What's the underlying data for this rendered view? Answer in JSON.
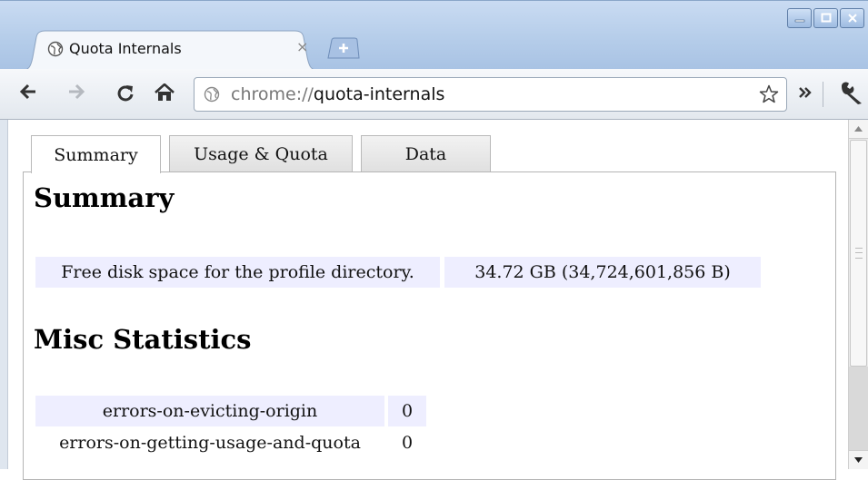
{
  "window": {
    "controls": [
      "minimize",
      "maximize",
      "close"
    ]
  },
  "tab": {
    "title": "Quota Internals",
    "close_glyph": "×",
    "favicon": "globe-icon"
  },
  "toolbar": {
    "icons": [
      "back-arrow-icon",
      "forward-arrow-icon",
      "reload-icon",
      "home-icon",
      "bookmark-star-icon",
      "overflow-chevron-icon",
      "wrench-icon"
    ],
    "url_scheme": "chrome://",
    "url_host": "quota-internals"
  },
  "page": {
    "tabs": [
      "Summary",
      "Usage & Quota",
      "Data"
    ],
    "active_tab": "Summary",
    "summary_heading": "Summary",
    "summary_row": {
      "label": "Free disk space for the profile directory.",
      "value": "34.72 GB (34,724,601,856 B)"
    },
    "misc_heading": "Misc Statistics",
    "statistics": [
      {
        "name": "errors-on-evicting-origin",
        "value": "0"
      },
      {
        "name": "errors-on-getting-usage-and-quota",
        "value": "0"
      }
    ]
  },
  "colors": {
    "shaded_cell": "#eeeeff",
    "frame": "#b4cce9"
  }
}
